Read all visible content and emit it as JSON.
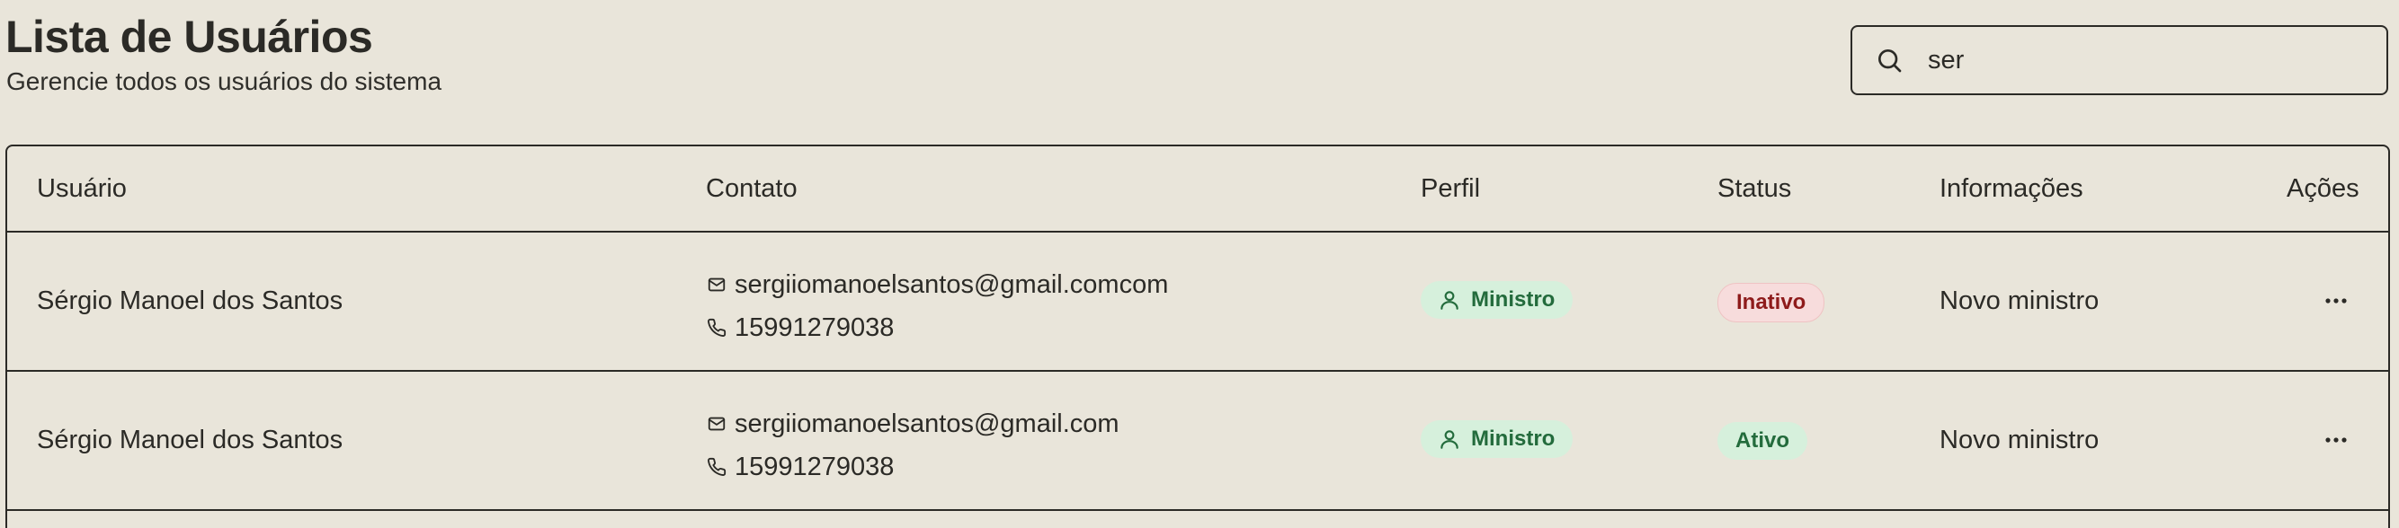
{
  "header": {
    "title": "Lista de Usuários",
    "subtitle": "Gerencie todos os usuários do sistema"
  },
  "search": {
    "value": "ser",
    "icon": "search-icon"
  },
  "table": {
    "columns": {
      "user": "Usuário",
      "contact": "Contato",
      "profile": "Perfil",
      "status": "Status",
      "info": "Informações",
      "actions": "Ações"
    },
    "rows": [
      {
        "name": "Sérgio Manoel dos Santos",
        "email": "sergiiomanoelsantos@gmail.comcom",
        "phone": "15991279038",
        "profile": "Ministro",
        "status": "Inativo",
        "info": "Novo ministro"
      },
      {
        "name": "Sérgio Manoel dos Santos",
        "email": "sergiiomanoelsantos@gmail.com",
        "phone": "15991279038",
        "profile": "Ministro",
        "status": "Ativo",
        "info": "Novo ministro"
      }
    ]
  },
  "colors": {
    "background": "#e9e5da",
    "border": "#2b2a26",
    "active_bg": "#d6f0dc",
    "active_text": "#236b3c",
    "inactive_bg": "#f7dcdc",
    "inactive_text": "#8e1b1b"
  }
}
